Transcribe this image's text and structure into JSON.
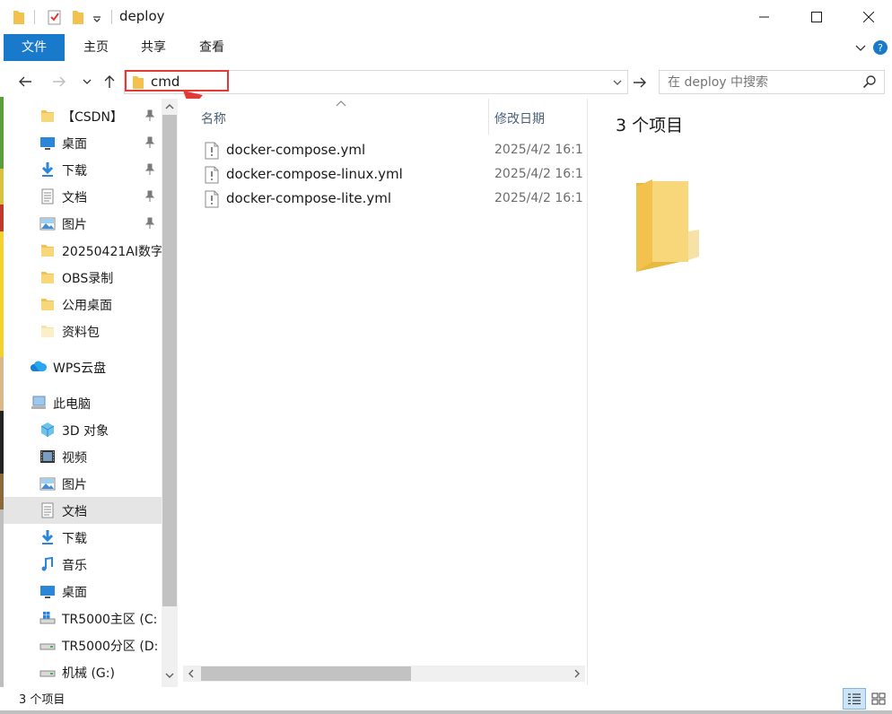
{
  "window": {
    "title": "deploy"
  },
  "window_controls": {
    "minimize": "—",
    "maximize": "☐",
    "close": "✕"
  },
  "ribbon": {
    "tabs": [
      "文件",
      "主页",
      "共享",
      "查看"
    ]
  },
  "address": {
    "value": "cmd"
  },
  "search": {
    "placeholder": "在 deploy 中搜索"
  },
  "sidebar": {
    "items": [
      {
        "label": "【CSDN】",
        "icon": "folder-icon",
        "pinned": true
      },
      {
        "label": "桌面",
        "icon": "desktop-icon",
        "pinned": true
      },
      {
        "label": "下载",
        "icon": "download-icon",
        "pinned": true
      },
      {
        "label": "文档",
        "icon": "document-icon",
        "pinned": true
      },
      {
        "label": "图片",
        "icon": "picture-icon",
        "pinned": true
      },
      {
        "label": "20250421AI数字",
        "icon": "folder-icon",
        "pinned": false
      },
      {
        "label": "OBS录制",
        "icon": "folder-icon",
        "pinned": false
      },
      {
        "label": "公用桌面",
        "icon": "folder-icon",
        "pinned": false
      },
      {
        "label": "资料包",
        "icon": "folder-light-icon",
        "pinned": false
      },
      {
        "label": "WPS云盘",
        "icon": "cloud-icon",
        "pinned": false
      },
      {
        "label": "此电脑",
        "icon": "computer-icon",
        "pinned": false
      },
      {
        "label": "3D 对象",
        "icon": "3d-objects-icon",
        "pinned": false
      },
      {
        "label": "视频",
        "icon": "video-icon",
        "pinned": false
      },
      {
        "label": "图片",
        "icon": "picture-icon",
        "pinned": false
      },
      {
        "label": "文档",
        "icon": "document-icon",
        "pinned": false
      },
      {
        "label": "下载",
        "icon": "download-icon",
        "pinned": false
      },
      {
        "label": "音乐",
        "icon": "music-icon",
        "pinned": false
      },
      {
        "label": "桌面",
        "icon": "desktop-icon",
        "pinned": false
      },
      {
        "label": "TR5000主区 (C:",
        "icon": "windows-drive-icon",
        "pinned": false
      },
      {
        "label": "TR5000分区 (D:",
        "icon": "drive-icon",
        "pinned": false
      },
      {
        "label": "机械 (G:)",
        "icon": "drive-icon",
        "pinned": false
      }
    ],
    "selected_index": 14
  },
  "file_list": {
    "columns": {
      "name": "名称",
      "modified": "修改日期"
    },
    "files": [
      {
        "name": "docker-compose.yml",
        "modified": "2025/4/2 16:1",
        "icon": "yml-file-icon"
      },
      {
        "name": "docker-compose-linux.yml",
        "modified": "2025/4/2 16:1",
        "icon": "yml-file-icon"
      },
      {
        "name": "docker-compose-lite.yml",
        "modified": "2025/4/2 16:1",
        "icon": "yml-file-icon"
      }
    ]
  },
  "preview": {
    "title": "3 个项目"
  },
  "status": {
    "text": "3 个项目"
  },
  "colors": {
    "accent": "#1979ca",
    "highlight": "#e53935",
    "folder": "#f2c14e",
    "selected_row": "#e5e5e5"
  }
}
